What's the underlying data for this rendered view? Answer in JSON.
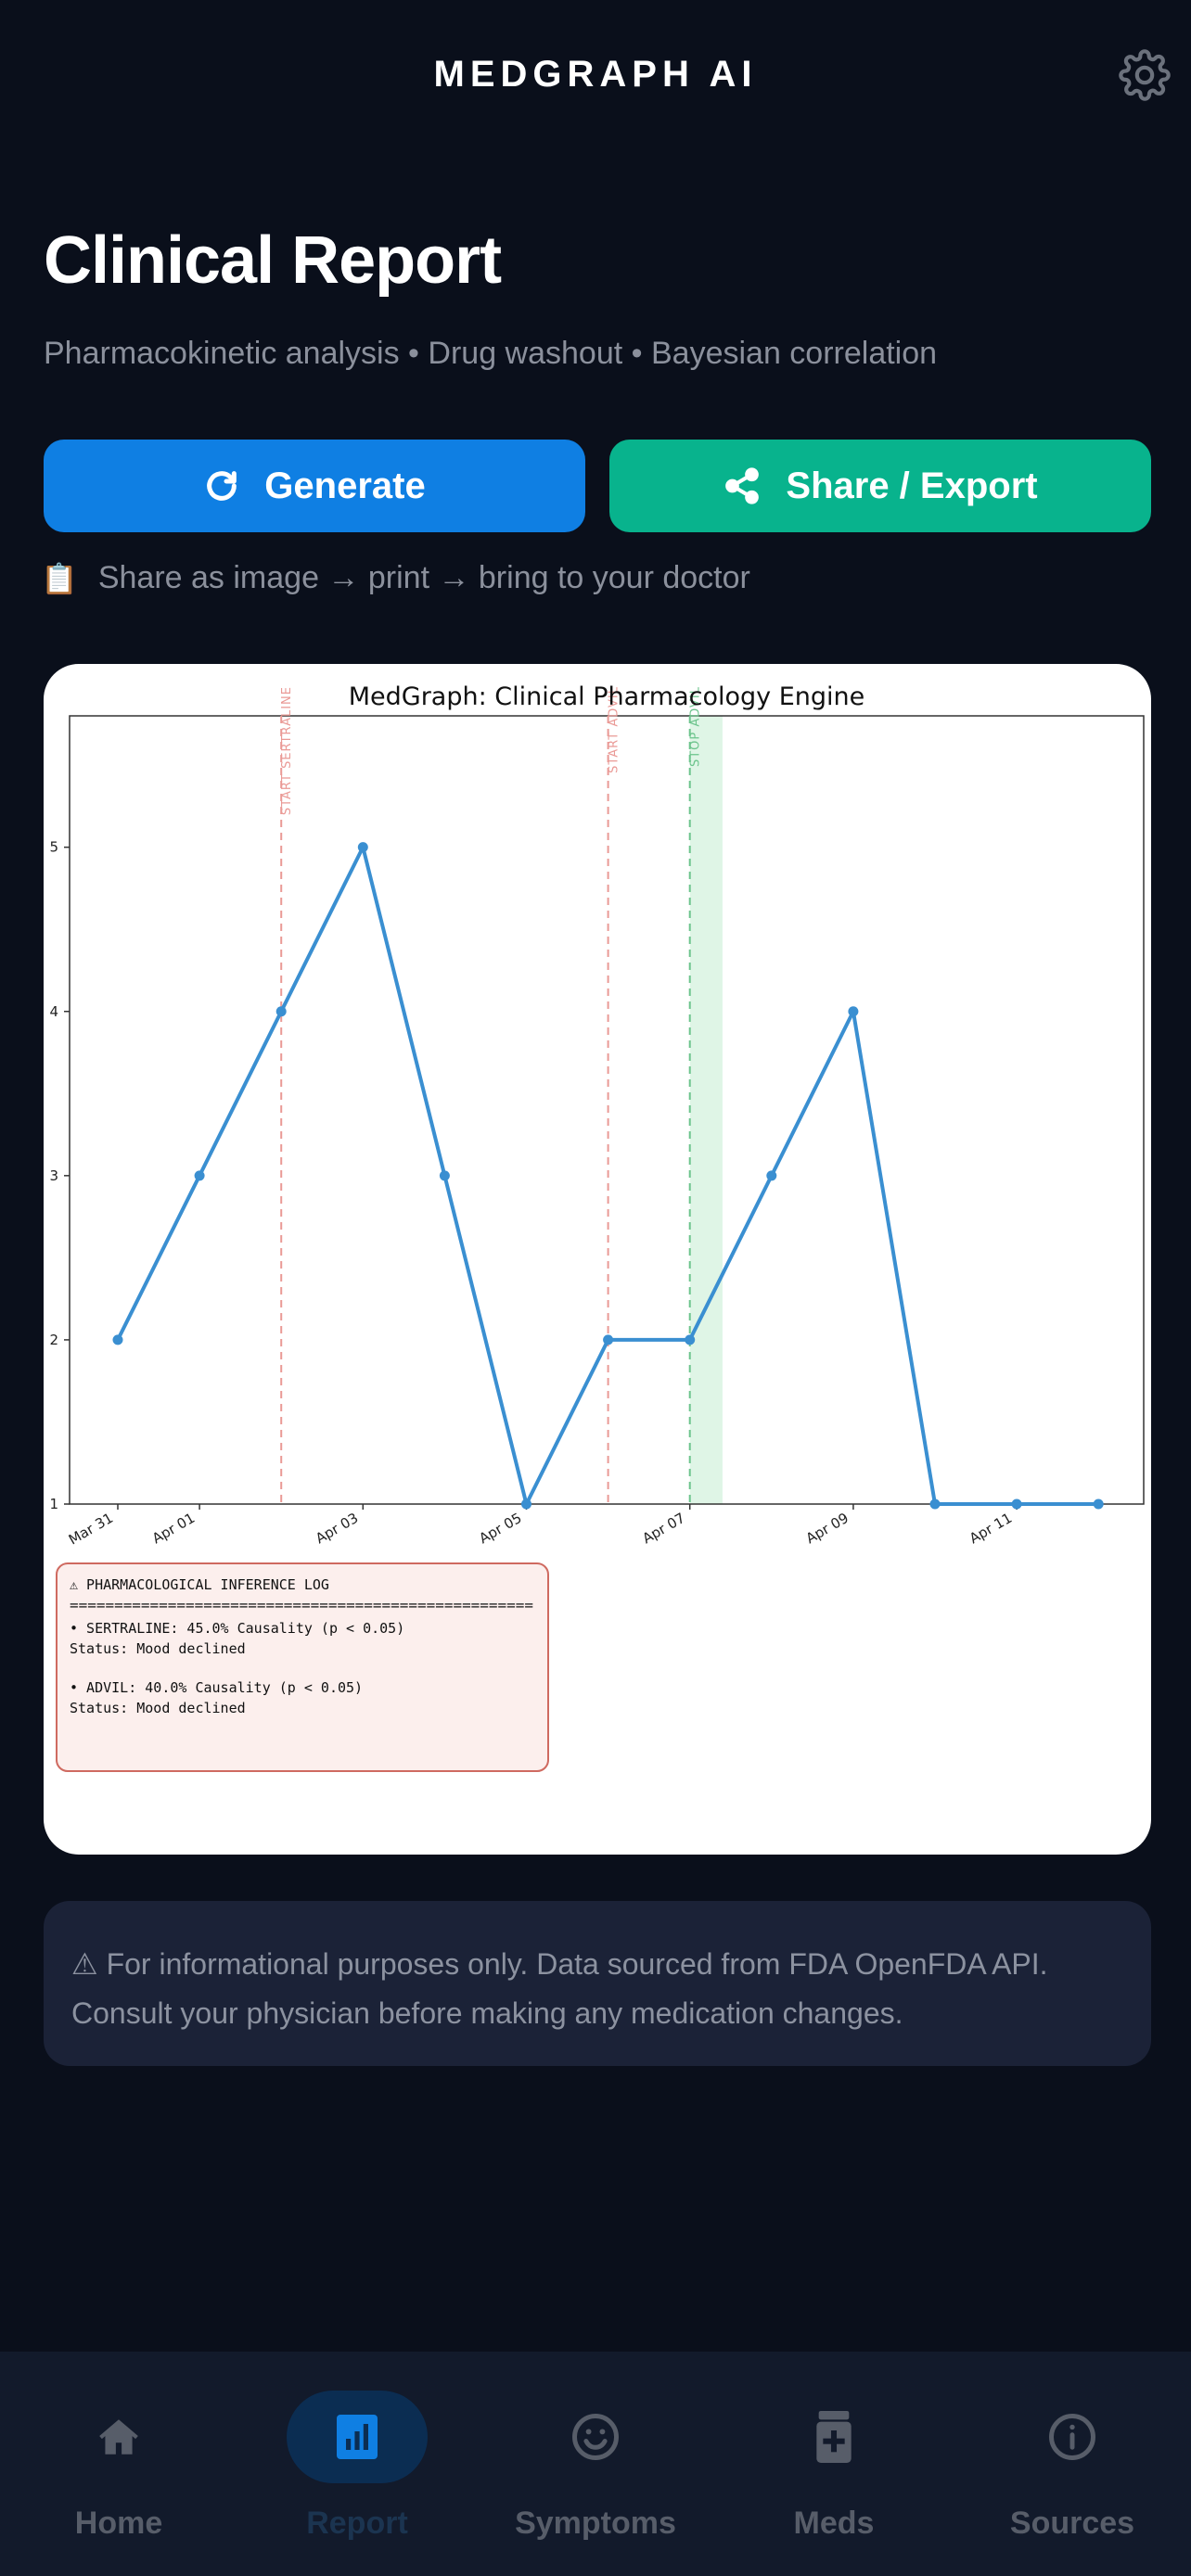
{
  "header": {
    "app_title": "MEDGRAPH AI"
  },
  "page": {
    "title": "Clinical Report",
    "subtitle": "Pharmacokinetic analysis • Drug washout • Bayesian correlation"
  },
  "actions": {
    "generate_label": "Generate",
    "share_label": "Share / Export"
  },
  "hint": {
    "icon": "clipboard-icon",
    "text": "Share as image → print → bring to your doctor"
  },
  "chart_data": {
    "type": "line",
    "title": "MedGraph: Clinical Pharmacology Engine",
    "xlabel": "",
    "ylabel": "",
    "x": [
      "2025-03-31",
      "2025-04-01",
      "2025-04-02",
      "2025-04-03",
      "2025-04-04",
      "2025-04-05",
      "2025-04-06",
      "2025-04-07",
      "2025-04-08",
      "2025-04-09",
      "2025-04-10",
      "2025-04-11",
      "2025-04-12"
    ],
    "x_tick_labels": [
      "Mar 31",
      "Apr 01",
      "Apr 03",
      "Apr 05",
      "Apr 07",
      "Apr 09",
      "Apr 11"
    ],
    "x_tick_dates": [
      "2025-03-31",
      "2025-04-01",
      "2025-04-03",
      "2025-04-05",
      "2025-04-07",
      "2025-04-09",
      "2025-04-11"
    ],
    "series": [
      {
        "values": [
          2,
          3,
          4,
          5,
          3,
          1,
          2,
          2,
          3,
          4,
          1,
          1,
          1
        ],
        "color": "#3a8fd1"
      }
    ],
    "ylim": [
      1,
      5.8
    ],
    "y_ticks": [
      1,
      2,
      3,
      4,
      5
    ],
    "grid": false,
    "events": [
      {
        "label": "START SERTRALINE",
        "date": "2025-04-02",
        "color": "#ea9a96"
      },
      {
        "label": "START ADVIL",
        "date": "2025-04-06",
        "color": "#ea9a96"
      },
      {
        "label": "STOP ADVIL",
        "date": "2025-04-07",
        "color": "#6cc48c"
      }
    ],
    "washout_band": {
      "from": "2025-04-07",
      "to": "2025-04-07.4",
      "color": "#dff5e6"
    },
    "inference_log": {
      "title": "⚠ PHARMACOLOGICAL INFERENCE LOG",
      "separator": "====================================================",
      "entries": [
        {
          "line1": "• SERTRALINE: 45.0% Causality (p < 0.05)",
          "line2": "  Status: Mood declined"
        },
        {
          "line1": "• ADVIL: 40.0% Causality (p < 0.05)",
          "line2": "  Status: Mood declined"
        }
      ]
    }
  },
  "disclaimer": "⚠ For informational purposes only. Data sourced from FDA OpenFDA API. Consult your physician before making any medication changes.",
  "tabs": [
    {
      "label": "Home",
      "icon": "home-icon",
      "active": false
    },
    {
      "label": "Report",
      "icon": "report-chart-icon",
      "active": true
    },
    {
      "label": "Symptoms",
      "icon": "smiley-icon",
      "active": false
    },
    {
      "label": "Meds",
      "icon": "pill-bottle-icon",
      "active": false
    },
    {
      "label": "Sources",
      "icon": "info-icon",
      "active": false
    }
  ],
  "colors": {
    "background": "#0a0f1b",
    "generate": "#0f7fe3",
    "share": "#08b38d",
    "tabbar": "#121a2b",
    "disclaimer_bg": "#1b2237"
  }
}
